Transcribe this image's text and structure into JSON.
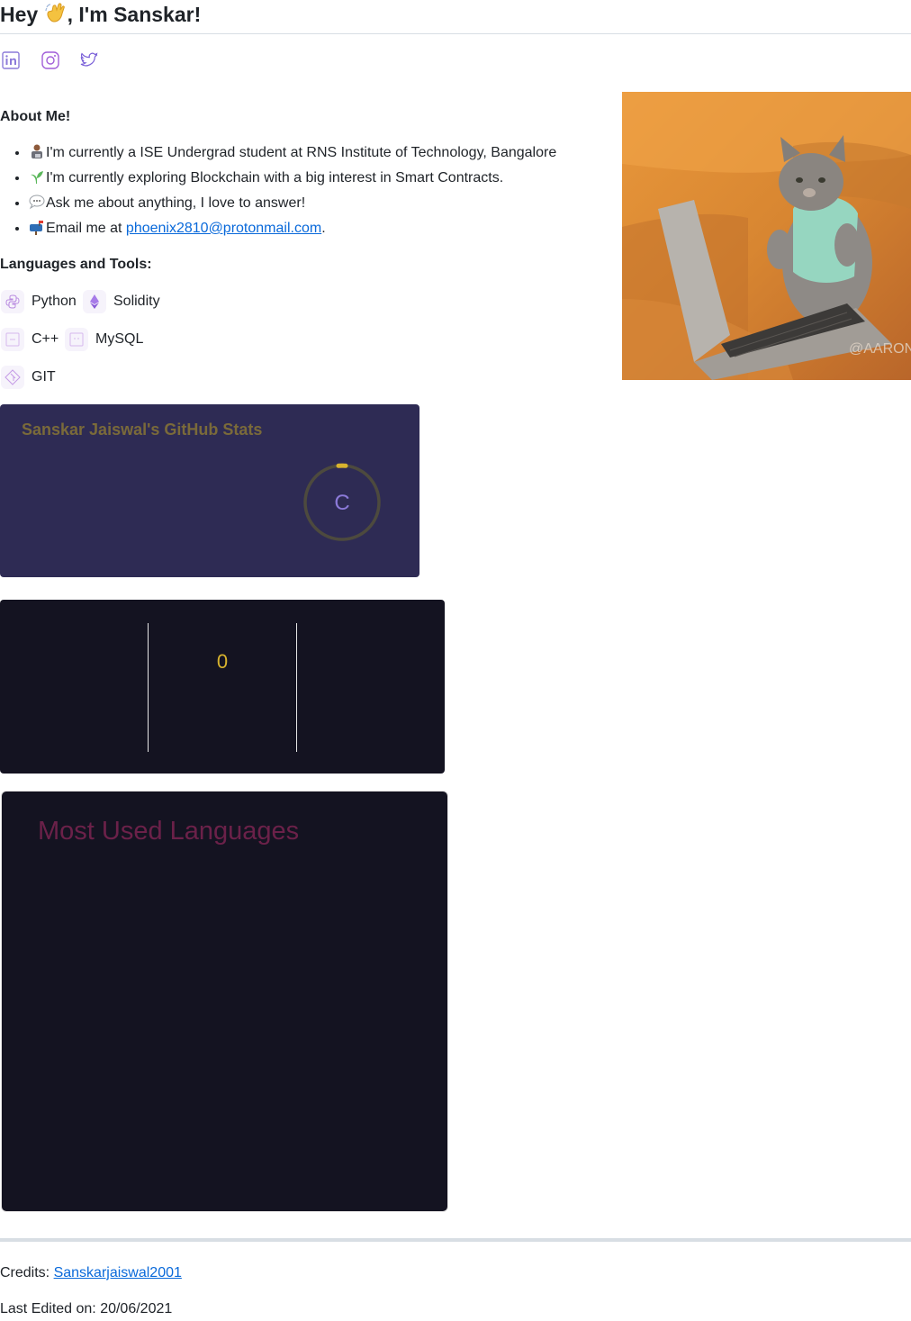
{
  "header": {
    "title_prefix": "Hey",
    "title_suffix": ", I'm Sanskar!"
  },
  "social": [
    {
      "name": "linkedin-icon",
      "color": "#8c7ad9"
    },
    {
      "name": "instagram-icon",
      "color": "#a15fd8"
    },
    {
      "name": "twitter-icon",
      "color": "#7a60d8"
    }
  ],
  "about": {
    "heading": "About Me!",
    "items": [
      {
        "icon": "student-emoji",
        "text": "I'm currently a ISE Undergrad student at RNS Institute of Technology, Bangalore"
      },
      {
        "icon": "seedling-emoji",
        "text": "I'm currently exploring Blockchain with a big interest in Smart Contracts."
      },
      {
        "icon": "speech-bubble-emoji",
        "text": "Ask me about anything, I love to answer!"
      },
      {
        "icon": "mailbox-emoji",
        "text_before": "Email me at ",
        "link": "phoenix2810@protonmail.com",
        "text_after": "."
      }
    ]
  },
  "tools": {
    "heading": "Languages and Tools:",
    "items": [
      {
        "label": "Python",
        "icon": "python-icon"
      },
      {
        "label": "Solidity",
        "icon": "solidity-icon"
      },
      {
        "label": "C++",
        "icon": "cplusplus-icon"
      },
      {
        "label": "MySQL",
        "icon": "mysql-icon"
      },
      {
        "label": "GIT",
        "icon": "git-icon"
      }
    ]
  },
  "stats_card": {
    "title": "Sanskar Jaiswal's GitHub Stats",
    "rank": "C",
    "colors": {
      "bg": "#2e2b54",
      "title": "#7a6a3a",
      "ring": "#4d4a3e",
      "ring_accent": "#d8b32e",
      "rank": "#8c7ad9"
    }
  },
  "streak_card": {
    "value": "0",
    "colors": {
      "bg": "#141321",
      "value": "#d8b32e"
    }
  },
  "languages_card": {
    "title": "Most Used Languages",
    "colors": {
      "bg": "#141321",
      "title": "#6b2149"
    }
  },
  "footer": {
    "credits_label": "Credits: ",
    "credits_link": "Sanskarjaiswal2001",
    "edited": "Last Edited on: 20/06/2021"
  }
}
